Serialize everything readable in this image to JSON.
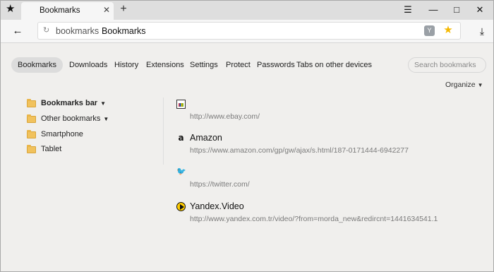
{
  "tab": {
    "title": "Bookmarks",
    "close": "✕",
    "new_tab": "+"
  },
  "window_controls": {
    "menu": "☰",
    "minimize": "—",
    "maximize": "□",
    "close": "✕"
  },
  "addressbar": {
    "back": "←",
    "reload": "↻",
    "host": "bookmarks",
    "title": "Bookmarks",
    "shield": "Y",
    "favorite": "★",
    "download": "⤓"
  },
  "nav": {
    "items": [
      "Bookmarks",
      "Downloads",
      "History",
      "Extensions",
      "Settings",
      "Protect",
      "Passwords",
      "Tabs on other devices"
    ],
    "active": "Bookmarks"
  },
  "search": {
    "placeholder": "Search bookmarks"
  },
  "organize": {
    "label": "Organize",
    "caret": "▼"
  },
  "folders": [
    {
      "label": "Bookmarks bar",
      "caret": "▼",
      "selected": true
    },
    {
      "label": "Other bookmarks",
      "caret": "▼",
      "selected": false
    },
    {
      "label": "Smartphone",
      "caret": "",
      "selected": false
    },
    {
      "label": "Tablet",
      "caret": "",
      "selected": false
    }
  ],
  "bookmarks": [
    {
      "title": "",
      "url": "http://www.ebay.com/",
      "icon": "ebay-icon"
    },
    {
      "title": "Amazon",
      "url": "https://www.amazon.com/gp/gw/ajax/s.html/187-0171444-6942277",
      "icon": "amazon-icon",
      "glyph": "a"
    },
    {
      "title": "",
      "url": "https://twitter.com/",
      "icon": "twitter-icon",
      "glyph": "🐦"
    },
    {
      "title": "Yandex.Video",
      "url": "http://www.yandex.com.tr/video/?from=morda_new&redircnt=1441634541.1",
      "icon": "yandex-video-icon"
    }
  ],
  "colors": {
    "accent_star": "#f5b800",
    "twitter": "#1da1f2",
    "folder": "#f1c25d",
    "background": "#f0efed"
  }
}
